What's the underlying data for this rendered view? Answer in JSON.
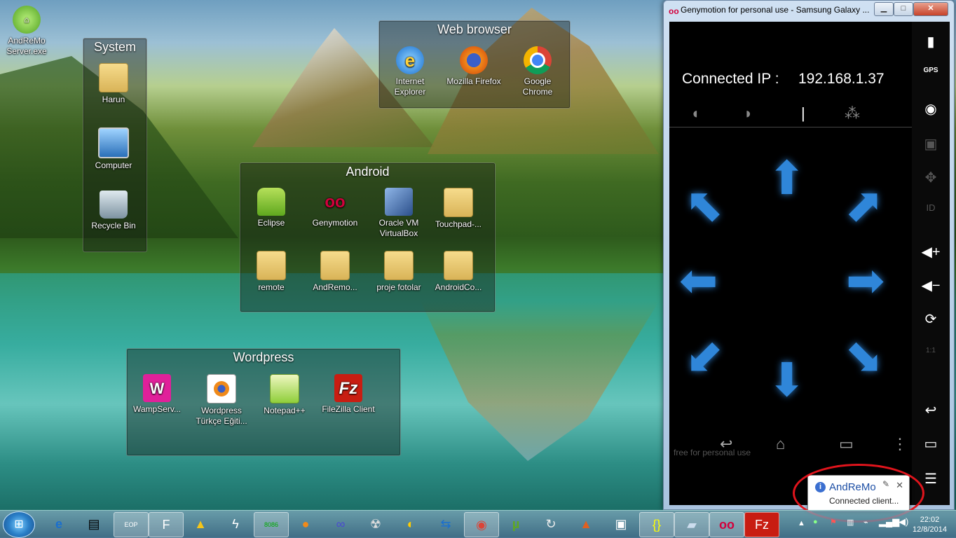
{
  "desktop": {
    "icons": [
      {
        "label": "AndReMo Server.exe"
      }
    ],
    "fences": {
      "system": {
        "title": "System",
        "items": [
          "Harun",
          "Computer",
          "Recycle Bin"
        ]
      },
      "web": {
        "title": "Web browser",
        "items": [
          "Internet Explorer",
          "Mozilla Firefox",
          "Google Chrome"
        ]
      },
      "android": {
        "title": "Android",
        "items": [
          "Eclipse",
          "Genymotion",
          "Oracle VM VirtualBox",
          "Touchpad-...",
          "remote",
          "AndRemo...",
          "proje fotolar",
          "AndroidCo..."
        ]
      },
      "wordpress": {
        "title": "Wordpress",
        "items": [
          "WampServ...",
          "Wordpress Türkçe Eğiti...",
          "Notepad++",
          "FileZilla Client"
        ]
      }
    }
  },
  "window": {
    "title": "Genymotion for personal use - Samsung Galaxy ...",
    "logo": "oo",
    "buttons": {
      "min": "▁",
      "max": "□",
      "close": "✕"
    },
    "app": {
      "conn_label": "Connected IP :",
      "ip": "192.168.1.37",
      "watermark": "free for personal use"
    },
    "side_icons": [
      "battery-icon",
      "gps-icon",
      "camera-icon",
      "clapper-icon",
      "dpad-icon",
      "id-icon",
      "volume-up-icon",
      "volume-down-icon",
      "rotate-icon",
      "scale-icon",
      "back-icon",
      "recents-icon",
      "menu-icon"
    ],
    "side_labels": {
      "gps": "GPS",
      "id": "ID",
      "scale": "1:1"
    }
  },
  "notification": {
    "title": "AndReMo",
    "body": "Connected client...",
    "close": "✕"
  },
  "taskbar": {
    "apps": [
      "Internet Explorer",
      "Windows Explorer",
      "EOP",
      "F",
      "Triangle",
      "Lightning",
      "8086",
      "Firefox",
      "Infinity",
      "Bot",
      "Banana",
      "TeamViewer",
      "Chrome",
      "uTorrent",
      "Sync",
      "Matlab",
      "Vbox",
      "Braces",
      "Paper",
      "Genymotion",
      "FileZilla"
    ],
    "clock": {
      "time": "22:02",
      "date": "12/8/2014"
    }
  }
}
